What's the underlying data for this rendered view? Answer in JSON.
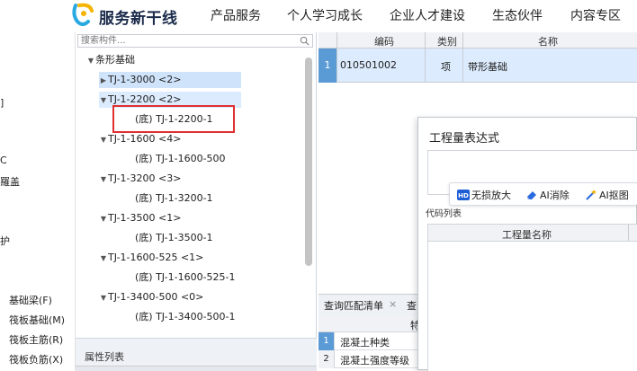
{
  "header": {
    "brand": "服务新干线",
    "nav": [
      "产品服务",
      "个人学习成长",
      "企业人才建设",
      "生态伙伴",
      "内容专区"
    ]
  },
  "left_strip": {
    "fragments": [
      "]",
      "C",
      "羅盖",
      "护"
    ],
    "items": [
      "基础梁(F)",
      "筏板基础(M)",
      "筏板主筋(R)",
      "筏板负筋(X)"
    ]
  },
  "tree": {
    "search_placeholder": "搜索构件...",
    "root": "条形基础",
    "nodes": [
      {
        "label": "TJ-1-3000 <2>",
        "expanded": false,
        "selected": true
      },
      {
        "label": "TJ-1-2200 <2>",
        "expanded": true,
        "selected": true
      },
      {
        "label": "(底) TJ-1-2200-1",
        "child": true
      },
      {
        "label": "TJ-1-1600 <4>",
        "expanded": true
      },
      {
        "label": "(底) TJ-1-1600-500",
        "child": true
      },
      {
        "label": "TJ-1-3200 <3>",
        "expanded": true
      },
      {
        "label": "(底) TJ-1-3200-1",
        "child": true
      },
      {
        "label": "TJ-1-3500 <1>",
        "expanded": true
      },
      {
        "label": "(底) TJ-1-3500-1",
        "child": true
      },
      {
        "label": "TJ-1-1600-525 <1>",
        "expanded": true
      },
      {
        "label": "(底) TJ-1-1600-525-1",
        "child": true
      },
      {
        "label": "TJ-1-3400-500 <0>",
        "expanded": true
      },
      {
        "label": "(底) TJ-1-3400-500-1",
        "child": true
      }
    ]
  },
  "properties": {
    "title": "属性列表"
  },
  "grid": {
    "headers": [
      "编码",
      "类别",
      "名称"
    ],
    "rows": [
      {
        "num": "1",
        "code": "010501002",
        "type": "项",
        "name": "带形基础"
      }
    ]
  },
  "bottom": {
    "tabs": [
      "查询匹配清单",
      "查"
    ],
    "close": "×",
    "col_header": "特",
    "rows": [
      {
        "num": "1",
        "text": "混凝土种类"
      },
      {
        "num": "2",
        "text": "混凝土强度等级"
      }
    ]
  },
  "dialog": {
    "title": "工程量表达式",
    "ai_tools": [
      "无损放大",
      "AI消除",
      "AI抠图"
    ],
    "hd_badge": "HD",
    "code_list_label": "代码列表",
    "code_list_col": "工程量名称"
  }
}
